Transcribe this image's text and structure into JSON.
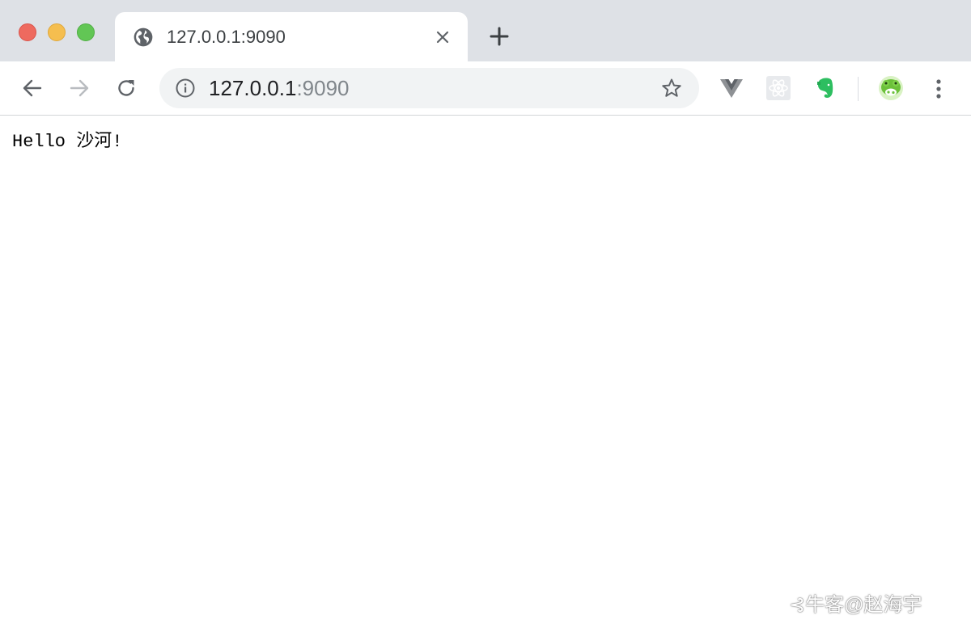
{
  "window": {
    "controls": [
      "close",
      "minimize",
      "zoom"
    ]
  },
  "tab": {
    "title": "127.0.0.1:9090",
    "icon": "globe-icon"
  },
  "toolbar": {
    "url_host": "127.0.0.1",
    "url_port": ":9090",
    "extensions": [
      "vue-devtools-icon",
      "react-devtools-icon",
      "evernote-icon",
      "frog-extension-icon"
    ]
  },
  "page": {
    "text": "Hello 沙河!"
  },
  "watermark": {
    "text": "牛客@赵海宇"
  },
  "colors": {
    "tabstrip": "#dee1e6",
    "close": "#ee6a5f",
    "minimize": "#f5be4f",
    "zoom": "#62c655",
    "evernote": "#2dbe60"
  }
}
